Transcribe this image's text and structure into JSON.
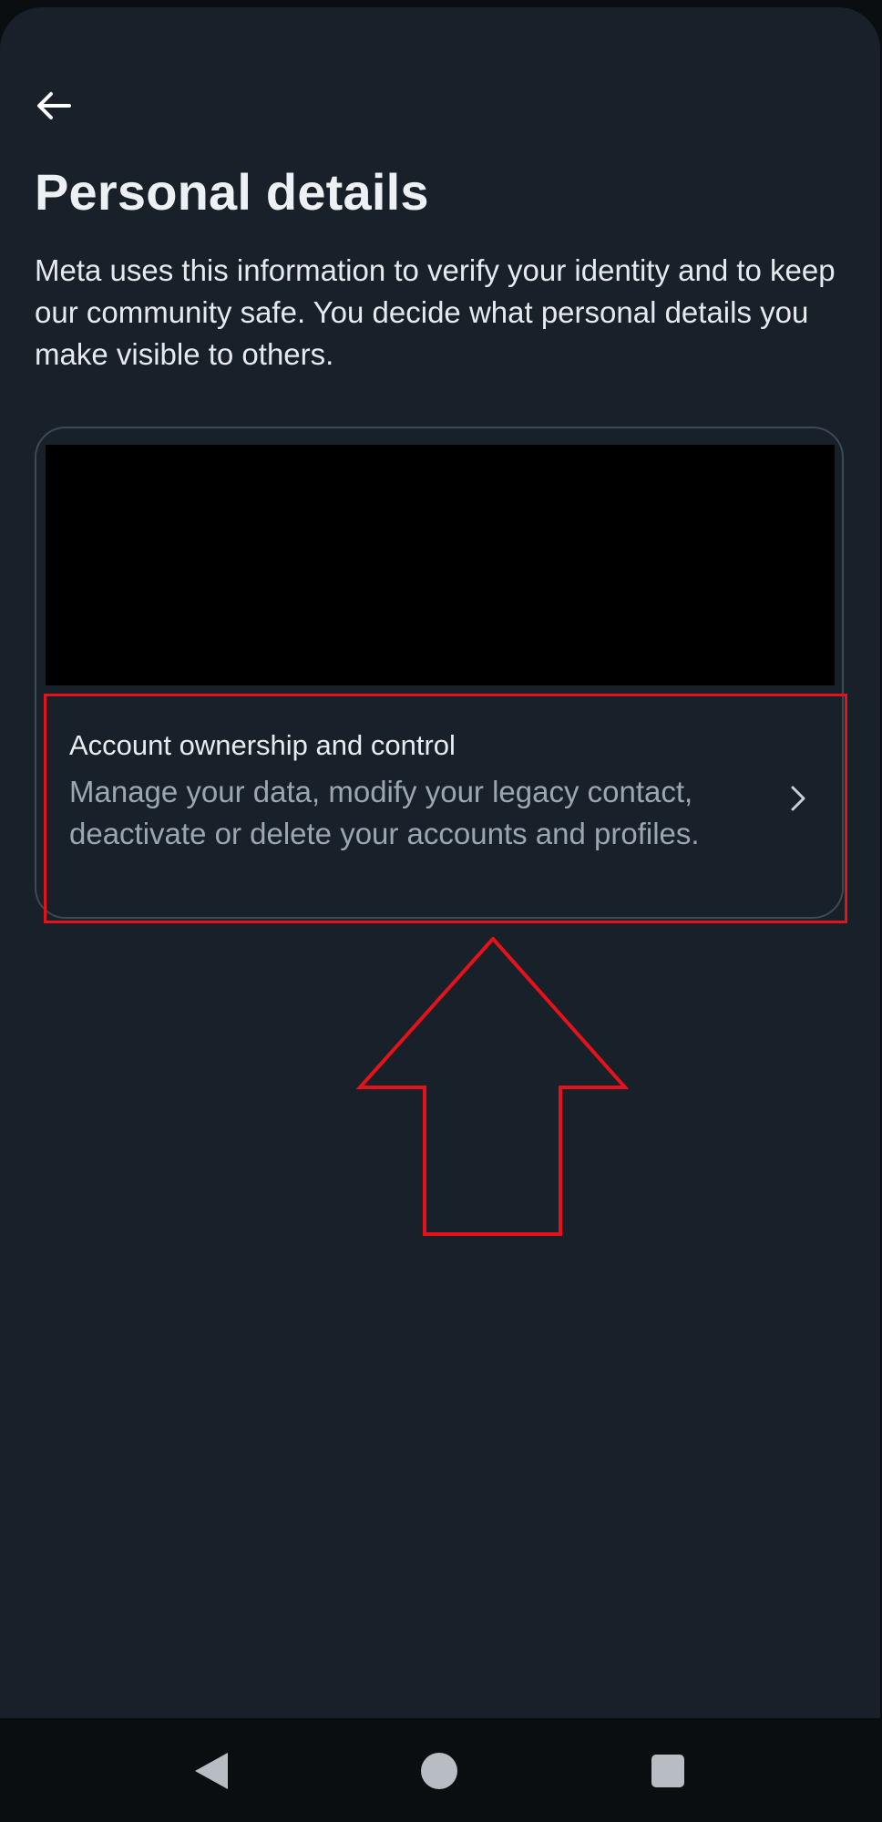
{
  "header": {
    "back_icon": "arrow-left-icon",
    "title": "Personal details",
    "description": "Meta uses this information to verify your identity and to keep our community safe. You decide what personal details you make visible to others."
  },
  "card": {
    "rows": [
      {
        "title": "Account ownership and control",
        "description": "Manage your data, modify your legacy contact, deactivate or delete your accounts and profiles.",
        "icon": "chevron-right-icon"
      }
    ]
  },
  "annotation": {
    "highlight_color": "#e5121b",
    "arrow_direction": "up"
  },
  "navigation": {
    "back_icon": "triangle-back-icon",
    "home_icon": "circle-home-icon",
    "recents_icon": "square-recents-icon"
  },
  "colors": {
    "background": "#18202a",
    "card_border": "#3c4957",
    "text_primary": "#eef1f4",
    "text_secondary": "#9aa6b2",
    "nav_background": "#0b0e11"
  }
}
